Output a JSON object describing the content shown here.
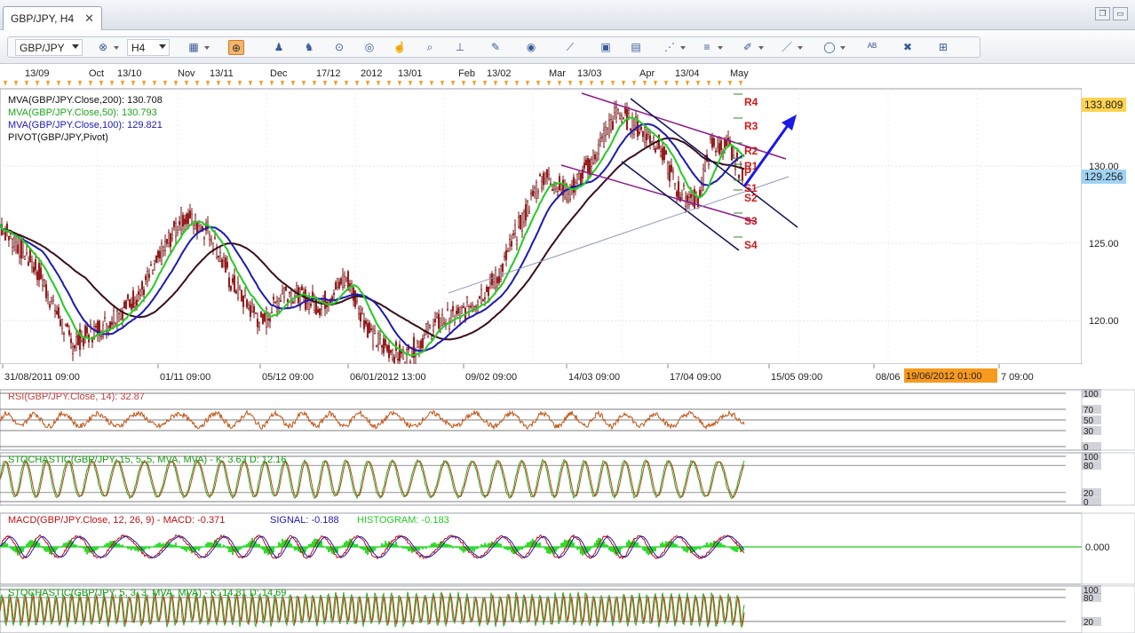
{
  "window": {
    "tab_title": "GBP/JPY, H4",
    "close_glyph": "✕"
  },
  "toolbar": {
    "symbol": "GBP/JPY",
    "timeframe": "H4"
  },
  "top_timeline": [
    "13/09",
    "Oct",
    "13/10",
    "Nov",
    "13/11",
    "Dec",
    "17/12",
    "2012",
    "13/01",
    "Feb",
    "13/02",
    "Mar",
    "13/03",
    "Apr",
    "13/04",
    "May"
  ],
  "bottom_timeline": [
    "31/08/2011 09:00",
    "01/11 09:00",
    "05/12 09:00",
    "06/01/2012 13:00",
    "09/02 09:00",
    "14/03 09:00",
    "17/04 09:00",
    "15/05 09:00",
    "08/06",
    "7 09:00"
  ],
  "crosshair_time": "19/06/2012 01:00",
  "main_legend": [
    {
      "text": "MVA(GBP/JPY.Close,200): 130.708",
      "color": "#111111"
    },
    {
      "text": "MVA(GBP/JPY.Close,50): 130.793",
      "color": "#1aa51a"
    },
    {
      "text": "MVA(GBP/JPY.Close,100): 129.821",
      "color": "#1a1ab4"
    },
    {
      "text": "PIVOT(GBP/JPY,Pivot)",
      "color": "#111111"
    }
  ],
  "price_axis": {
    "labels": [
      "130.00",
      "125.00",
      "120.00"
    ],
    "current_high": "133.809",
    "current_price": "129.256"
  },
  "pivot_labels": [
    "R4",
    "R3",
    "R2",
    "R1",
    "P",
    "S1",
    "S2",
    "S3",
    "S4"
  ],
  "rsi": {
    "legend": "RSI(GBP/JPY.Close, 14): 32.87",
    "levels": [
      "100",
      "70",
      "50",
      "30",
      "0"
    ]
  },
  "stoch1": {
    "legend": "STOCHASTIC(GBP/JPY, 15, 5, 5, MVA, MVA) -  K: 3.63   D: 12.16",
    "levels": [
      "100",
      "80",
      "20",
      "0"
    ]
  },
  "macd": {
    "legend_main": "MACD(GBP/JPY.Close, 12, 26, 9) - MACD: -0.371",
    "legend_signal": "SIGNAL: -0.188",
    "legend_hist": "HISTOGRAM: -0.183",
    "zero": "0.000"
  },
  "stoch2": {
    "legend": "STOCHASTIC(GBP/JPY, 5, 3, 3, MVA, MVA) -  K: 14.81   D: 14.69",
    "levels": [
      "100",
      "80",
      "20"
    ]
  },
  "colors": {
    "accent_orange": "#f79a1e",
    "price_highlight": "#ffd44f",
    "current_price_bg": "#9fd3f5",
    "pivot_red": "#d01818",
    "arrow_blue": "#1a1ae6"
  },
  "icons": [
    "chart-type-icon",
    "crosshair-icon",
    "candle-icon",
    "bar-icon",
    "zoom-icon",
    "zoom-out-icon",
    "cursor-icon",
    "magnify-icon",
    "indicator-icon",
    "draw-icon",
    "globe-icon",
    "ruler-icon",
    "picture-icon",
    "window-icon",
    "trendline-icon",
    "fibo-icon",
    "pencil-icon",
    "line-icon",
    "ellipse-icon",
    "text-icon",
    "eraser-icon",
    "tree-icon"
  ]
}
